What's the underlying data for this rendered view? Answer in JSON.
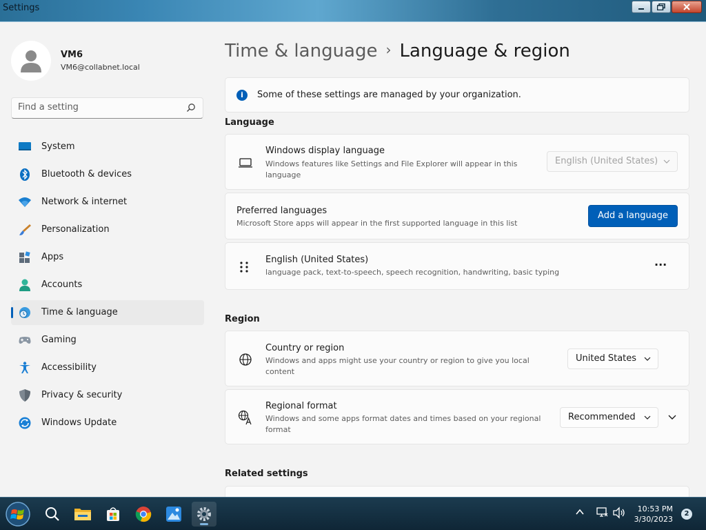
{
  "window": {
    "title": "Settings"
  },
  "user": {
    "name": "VM6",
    "email": "VM6@collabnet.local"
  },
  "search": {
    "placeholder": "Find a setting"
  },
  "sidebar": {
    "items": [
      {
        "label": "System",
        "icon": "monitor-icon"
      },
      {
        "label": "Bluetooth & devices",
        "icon": "bluetooth-icon"
      },
      {
        "label": "Network & internet",
        "icon": "wifi-icon"
      },
      {
        "label": "Personalization",
        "icon": "brush-icon"
      },
      {
        "label": "Apps",
        "icon": "apps-icon"
      },
      {
        "label": "Accounts",
        "icon": "person-icon"
      },
      {
        "label": "Time & language",
        "icon": "globe-clock-icon",
        "active": true
      },
      {
        "label": "Gaming",
        "icon": "gamepad-icon"
      },
      {
        "label": "Accessibility",
        "icon": "accessibility-icon"
      },
      {
        "label": "Privacy & security",
        "icon": "shield-icon"
      },
      {
        "label": "Windows Update",
        "icon": "update-icon"
      }
    ]
  },
  "breadcrumb": {
    "parent": "Time & language",
    "separator": "›",
    "current": "Language & region"
  },
  "info_banner": {
    "text": "Some of these settings are managed by your organization."
  },
  "language": {
    "heading": "Language",
    "display_language": {
      "title": "Windows display language",
      "description": "Windows features like Settings and File Explorer will appear in this language",
      "value": "English (United States)"
    },
    "preferred": {
      "title": "Preferred languages",
      "description": "Microsoft Store apps will appear in the first supported language in this list",
      "button": "Add a language"
    },
    "installed": {
      "title": "English (United States)",
      "description": "language pack, text-to-speech, speech recognition, handwriting, basic typing",
      "more": "···"
    }
  },
  "region": {
    "heading": "Region",
    "country": {
      "title": "Country or region",
      "description": "Windows and apps might use your country or region to give you local content",
      "value": "United States"
    },
    "format": {
      "title": "Regional format",
      "description": "Windows and some apps format dates and times based on your regional format",
      "value": "Recommended"
    }
  },
  "related": {
    "heading": "Related settings"
  },
  "taskbar": {
    "time": "10:53 PM",
    "date": "3/30/2023",
    "notifications": "2"
  },
  "colors": {
    "accent": "#005fb8"
  }
}
